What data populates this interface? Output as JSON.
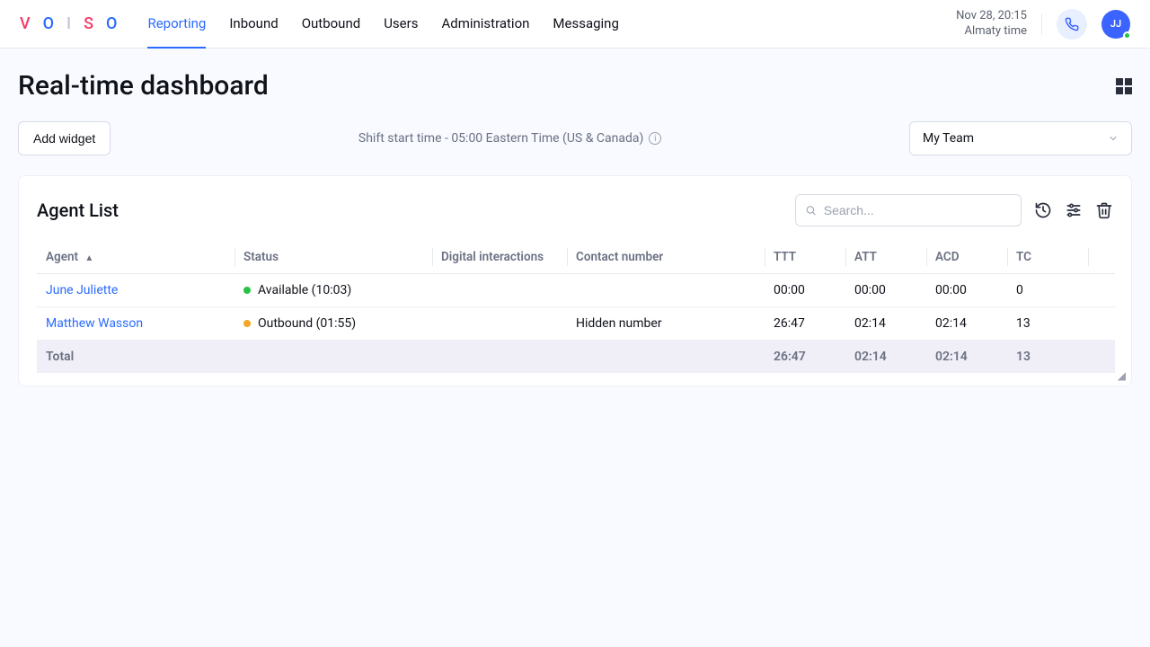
{
  "header": {
    "nav": {
      "reporting": "Reporting",
      "inbound": "Inbound",
      "outbound": "Outbound",
      "users": "Users",
      "administration": "Administration",
      "messaging": "Messaging"
    },
    "datetime": "Nov 28, 20:15",
    "timezone": "Almaty time",
    "avatar_initials": "JJ"
  },
  "page": {
    "title": "Real-time dashboard",
    "add_widget": "Add widget",
    "shift_note": "Shift start time - 05:00 Eastern Time (US & Canada)",
    "team_selector": "My Team"
  },
  "widget": {
    "title": "Agent List",
    "search_placeholder": "Search...",
    "columns": {
      "agent": "Agent",
      "status": "Status",
      "digital": "Digital interactions",
      "contact": "Contact number",
      "ttt": "TTT",
      "att": "ATT",
      "acd": "ACD",
      "tc": "TC"
    },
    "rows": [
      {
        "agent": "June Juliette",
        "status_color": "green",
        "status": "Available (10:03)",
        "digital": "",
        "contact": "",
        "ttt": "00:00",
        "att": "00:00",
        "acd": "00:00",
        "tc": "0"
      },
      {
        "agent": "Matthew Wasson",
        "status_color": "orange",
        "status": "Outbound (01:55)",
        "digital": "",
        "contact": "Hidden number",
        "ttt": "26:47",
        "att": "02:14",
        "acd": "02:14",
        "tc": "13"
      }
    ],
    "total": {
      "label": "Total",
      "ttt": "26:47",
      "att": "02:14",
      "acd": "02:14",
      "tc": "13"
    }
  }
}
